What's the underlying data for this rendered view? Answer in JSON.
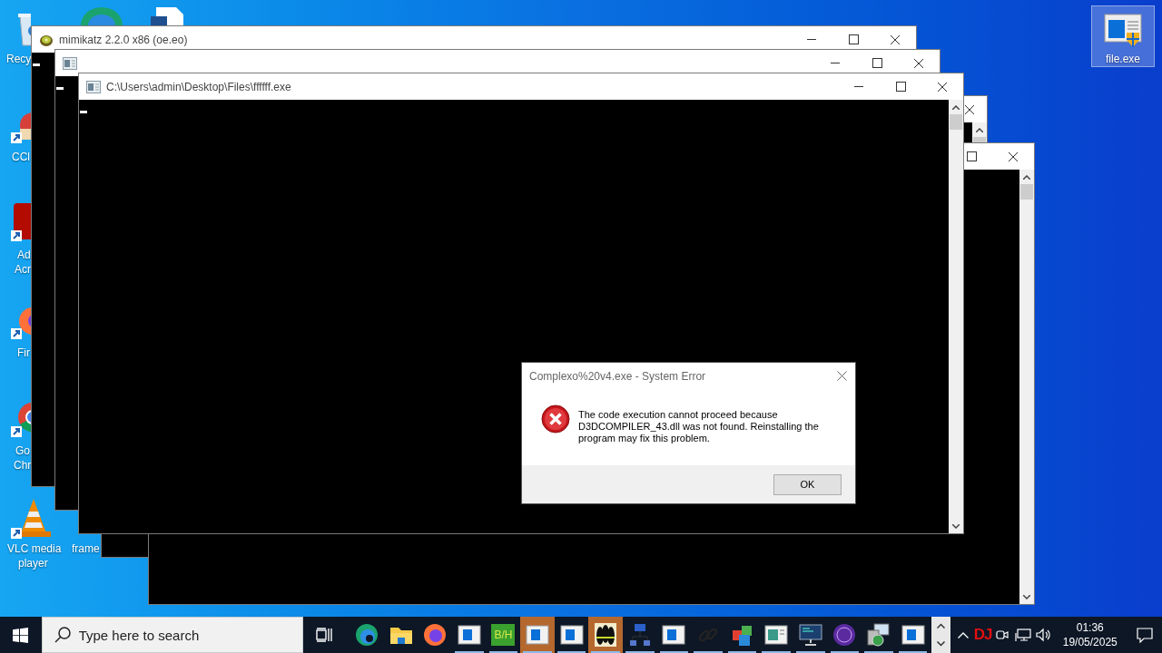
{
  "desktop_icons": [
    {
      "lines": [
        "Recy"
      ],
      "selected": false
    },
    {
      "lines": [
        "CCl"
      ],
      "selected": false
    },
    {
      "lines": [
        "Ad",
        "Acr"
      ],
      "selected": false
    },
    {
      "lines": [
        "Fir"
      ],
      "selected": false
    },
    {
      "lines": [
        "Go",
        "Chr"
      ],
      "selected": false
    },
    {
      "lines": [
        "VLC media",
        "player"
      ],
      "selected": false
    },
    {
      "lines": [
        "frame"
      ],
      "selected": false
    },
    {
      "lines": [
        "file.exe"
      ],
      "selected": true
    }
  ],
  "windows": [
    {
      "kind": "blank"
    },
    {
      "kind": "blank"
    },
    {
      "kind": "kiwi",
      "title": "mimikatz 2.2.0 x86 (oe.eo)"
    },
    {
      "kind": "console"
    },
    {
      "kind": "console",
      "title": "C:\\Users\\admin\\Desktop\\Files\\ffffff.exe"
    }
  ],
  "dialog": {
    "title": "Complexo%20v4.exe - System Error",
    "message": "The code execution cannot proceed because D3DCOMPILER_43.dll was not found. Reinstalling the program may fix this problem.",
    "button": "OK"
  },
  "taskbar": {
    "search": {
      "placeholder": "Type here to search"
    },
    "apps": [
      {
        "running": false,
        "selected": false
      },
      {
        "running": false,
        "selected": false
      },
      {
        "running": false,
        "selected": false
      },
      {
        "running": true,
        "selected": false
      },
      {
        "running": true,
        "selected": false,
        "label": "B/H"
      },
      {
        "running": true,
        "selected": true
      },
      {
        "running": true,
        "selected": false
      },
      {
        "running": true,
        "selected": true
      },
      {
        "running": true,
        "selected": false
      },
      {
        "running": true,
        "selected": false
      },
      {
        "running": true,
        "selected": false
      },
      {
        "running": true,
        "selected": false
      },
      {
        "running": true,
        "selected": false
      },
      {
        "running": true,
        "selected": false
      },
      {
        "running": true,
        "selected": false
      },
      {
        "running": true,
        "selected": false
      },
      {
        "running": true,
        "selected": false
      }
    ],
    "tray_badge": "DJ",
    "time": "01:36",
    "date": "19/05/2025"
  }
}
